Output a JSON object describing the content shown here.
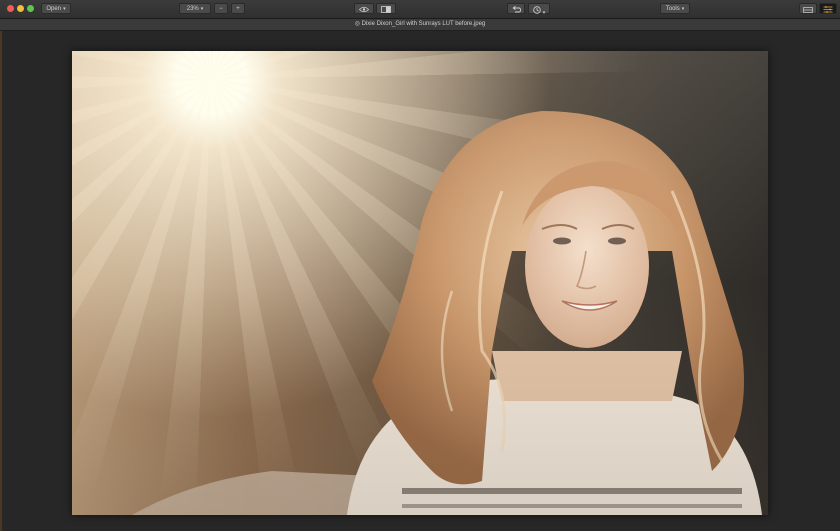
{
  "toolbar": {
    "open_label": "Open",
    "zoom_value": "23%",
    "zoom_out_label": "−",
    "zoom_in_label": "+",
    "tools_label": "Tools"
  },
  "document": {
    "title": "◎ Dixie Dixon_Girl with Sunrays LUT before.jpeg"
  },
  "icons": {
    "window_close": "close-circle",
    "window_minimize": "minimize-circle",
    "window_zoom": "zoom-circle",
    "preview": "eye-icon",
    "compare": "compare-icon",
    "undo": "undo-icon",
    "history": "clock-icon",
    "layout": "panel-layout-icon",
    "adjust": "sliders-icon"
  },
  "colors": {
    "toolbar_bg": "#333333",
    "canvas_bg": "#272727",
    "traffic_red": "#ed5f56",
    "traffic_yellow": "#f4bd3c",
    "traffic_green": "#5fc64f"
  }
}
